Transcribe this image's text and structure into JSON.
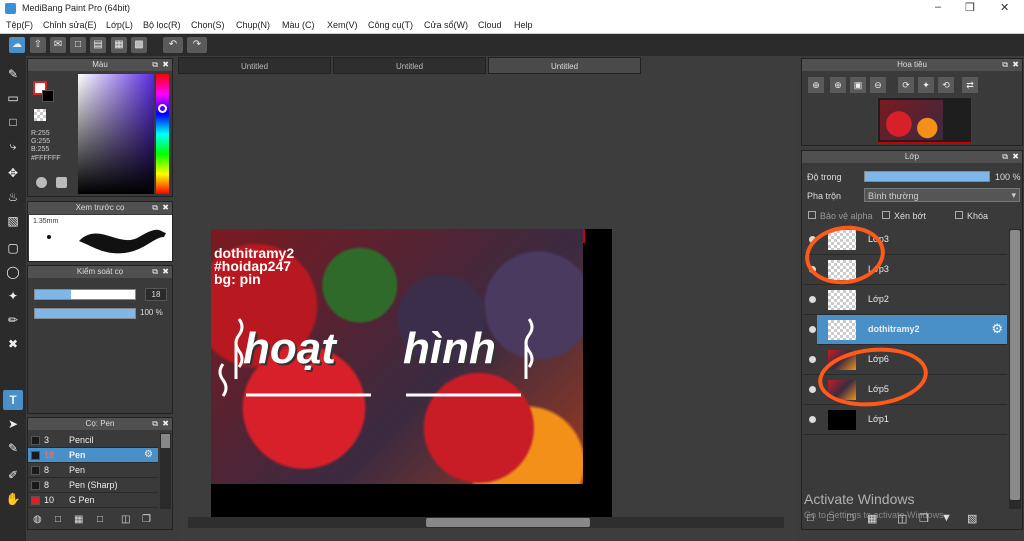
{
  "title": "MediBang Paint Pro (64bit)",
  "menu": [
    "Tệp(F)",
    "Chỉnh sửa(E)",
    "Lớp(L)",
    "Bộ lọc(R)",
    "Chọn(S)",
    "Chụp(N)",
    "Màu (C)",
    "Xem(V)",
    "Công cụ(T)",
    "Cửa sổ(W)",
    "Cloud",
    "Help"
  ],
  "tabs": [
    "Untitled",
    "Untitled",
    "Untitled"
  ],
  "color_panel": {
    "title": "Màu",
    "r": "R:255",
    "g": "G:255",
    "b": "B:255",
    "hex": "#FFFFFF"
  },
  "brush_preview": {
    "title": "Xem trước cọ",
    "size": "1.35mm"
  },
  "brush_control": {
    "title": "Kiểm soát cọ",
    "size": "18",
    "opacity": "100 %"
  },
  "brush_list": {
    "title": "Cọ: Pen",
    "items": [
      {
        "size": "3",
        "name": "Pencil",
        "color": "#1a1a1a"
      },
      {
        "size": "18",
        "name": "Pen",
        "color": "#1a1a1a",
        "selected": true
      },
      {
        "size": "8",
        "name": "Pen",
        "color": "#1a1a1a"
      },
      {
        "size": "8",
        "name": "Pen (Sharp)",
        "color": "#1a1a1a"
      },
      {
        "size": "10",
        "name": "G Pen",
        "color": "#e02020"
      }
    ]
  },
  "navigator": {
    "title": "Hoa tiêu"
  },
  "layers_panel": {
    "title": "Lớp",
    "opacity_label": "Độ trong",
    "opacity_value": "100 %",
    "blend_label": "Pha trộn",
    "blend_value": "Bình thường",
    "opt1": "Bảo vệ alpha",
    "opt2": "Xén bớt",
    "opt3": "Khóa",
    "layers": [
      {
        "name": "Lớp3"
      },
      {
        "name": "Lớp3"
      },
      {
        "name": "Lớp2"
      },
      {
        "name": "dothitramy2",
        "selected": true
      },
      {
        "name": "Lớp6",
        "photo": true
      },
      {
        "name": "Lớp5",
        "photo": true
      },
      {
        "name": "Lớp1",
        "black": true
      }
    ]
  },
  "artwork": {
    "line1": "dothitramy2",
    "line2": "#hoidap247",
    "line3": "bg: pin",
    "word1": "hoạt",
    "word2": "hình"
  },
  "watermark": {
    "line1": "Activate Windows",
    "line2": "Go to Settings to activate Windows."
  },
  "colors": {
    "accent": "#4a90c8",
    "annotation": "#ff5a1a"
  }
}
